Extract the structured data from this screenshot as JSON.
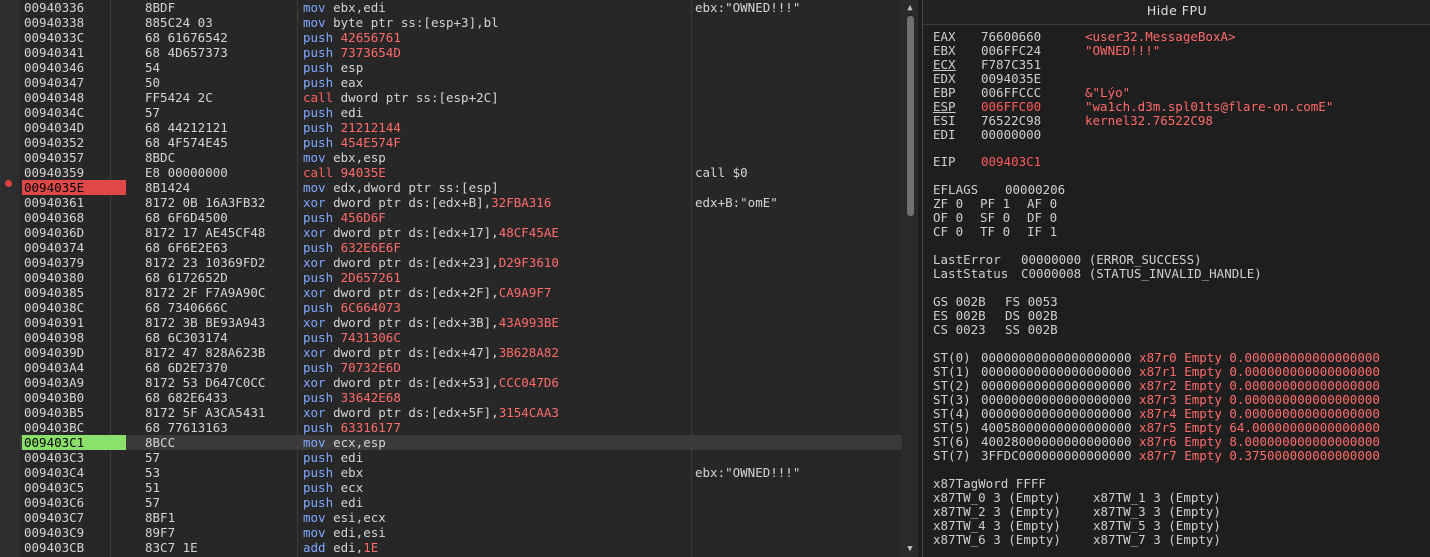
{
  "disasm": {
    "rows": [
      {
        "addr": "00940336",
        "bytes": "8BDF",
        "mn": "mov",
        "ops": "ebx,edi",
        "opsr": "",
        "cmt": "ebx:\"OWNED!!!\"",
        "mark": ""
      },
      {
        "addr": "00940338",
        "bytes": "885C24 03",
        "mn": "mov",
        "ops": "byte ptr ss:[esp+3],bl",
        "opsr": "",
        "cmt": "",
        "mark": ""
      },
      {
        "addr": "0094033C",
        "bytes": "68 61676542",
        "mn": "push",
        "ops": "",
        "opsr": "42656761",
        "cmt": "",
        "mark": ""
      },
      {
        "addr": "00940341",
        "bytes": "68 4D657373",
        "mn": "push",
        "ops": "",
        "opsr": "7373654D",
        "cmt": "",
        "mark": ""
      },
      {
        "addr": "00940346",
        "bytes": "54",
        "mn": "push",
        "ops": "esp",
        "opsr": "",
        "cmt": "",
        "mark": ""
      },
      {
        "addr": "00940347",
        "bytes": "50",
        "mn": "push",
        "ops": "eax",
        "opsr": "",
        "cmt": "",
        "mark": ""
      },
      {
        "addr": "00940348",
        "bytes": "FF5424 2C",
        "mn": "call",
        "ops": "dword ptr ss:[esp+2C]",
        "opsr": "",
        "cmt": "",
        "mark": ""
      },
      {
        "addr": "0094034C",
        "bytes": "57",
        "mn": "push",
        "ops": "edi",
        "opsr": "",
        "cmt": "",
        "mark": ""
      },
      {
        "addr": "0094034D",
        "bytes": "68 44212121",
        "mn": "push",
        "ops": "",
        "opsr": "21212144",
        "cmt": "",
        "mark": ""
      },
      {
        "addr": "00940352",
        "bytes": "68 4F574E45",
        "mn": "push",
        "ops": "",
        "opsr": "454E574F",
        "cmt": "",
        "mark": ""
      },
      {
        "addr": "00940357",
        "bytes": "8BDC",
        "mn": "mov",
        "ops": "ebx,esp",
        "opsr": "",
        "cmt": "",
        "mark": ""
      },
      {
        "addr": "00940359",
        "bytes": "E8 00000000",
        "mn": "call",
        "ops": "",
        "opsr": "94035E",
        "cmt": "call $0",
        "mark": ""
      },
      {
        "addr": "0094035E",
        "bytes": "8B1424",
        "mn": "mov",
        "ops": "edx,dword ptr ss:[esp]",
        "opsr": "",
        "cmt": "",
        "mark": "bp"
      },
      {
        "addr": "00940361",
        "bytes": "8172 0B 16A3FB32",
        "mn": "xor",
        "ops": "dword ptr ds:[edx+B],",
        "opsr": "32FBA316",
        "cmt": "edx+B:\"omE\"",
        "mark": ""
      },
      {
        "addr": "00940368",
        "bytes": "68 6F6D4500",
        "mn": "push",
        "ops": "",
        "opsr": "456D6F",
        "cmt": "",
        "mark": ""
      },
      {
        "addr": "0094036D",
        "bytes": "8172 17 AE45CF48",
        "mn": "xor",
        "ops": "dword ptr ds:[edx+17],",
        "opsr": "48CF45AE",
        "cmt": "",
        "mark": ""
      },
      {
        "addr": "00940374",
        "bytes": "68 6F6E2E63",
        "mn": "push",
        "ops": "",
        "opsr": "632E6E6F",
        "cmt": "",
        "mark": ""
      },
      {
        "addr": "00940379",
        "bytes": "8172 23 10369FD2",
        "mn": "xor",
        "ops": "dword ptr ds:[edx+23],",
        "opsr": "D29F3610",
        "cmt": "",
        "mark": ""
      },
      {
        "addr": "00940380",
        "bytes": "68 6172652D",
        "mn": "push",
        "ops": "",
        "opsr": "2D657261",
        "cmt": "",
        "mark": ""
      },
      {
        "addr": "00940385",
        "bytes": "8172 2F F7A9A90C",
        "mn": "xor",
        "ops": "dword ptr ds:[edx+2F],",
        "opsr": "CA9A9F7",
        "cmt": "",
        "mark": ""
      },
      {
        "addr": "0094038C",
        "bytes": "68 7340666C",
        "mn": "push",
        "ops": "",
        "opsr": "6C664073",
        "cmt": "",
        "mark": ""
      },
      {
        "addr": "00940391",
        "bytes": "8172 3B BE93A943",
        "mn": "xor",
        "ops": "dword ptr ds:[edx+3B],",
        "opsr": "43A993BE",
        "cmt": "",
        "mark": ""
      },
      {
        "addr": "00940398",
        "bytes": "68 6C303174",
        "mn": "push",
        "ops": "",
        "opsr": "7431306C",
        "cmt": "",
        "mark": ""
      },
      {
        "addr": "0094039D",
        "bytes": "8172 47 828A623B",
        "mn": "xor",
        "ops": "dword ptr ds:[edx+47],",
        "opsr": "3B628A82",
        "cmt": "",
        "mark": ""
      },
      {
        "addr": "009403A4",
        "bytes": "68 6D2E7370",
        "mn": "push",
        "ops": "",
        "opsr": "70732E6D",
        "cmt": "",
        "mark": ""
      },
      {
        "addr": "009403A9",
        "bytes": "8172 53 D647C0CC",
        "mn": "xor",
        "ops": "dword ptr ds:[edx+53],",
        "opsr": "CCC047D6",
        "cmt": "",
        "mark": ""
      },
      {
        "addr": "009403B0",
        "bytes": "68 682E6433",
        "mn": "push",
        "ops": "",
        "opsr": "33642E68",
        "cmt": "",
        "mark": ""
      },
      {
        "addr": "009403B5",
        "bytes": "8172 5F A3CA5431",
        "mn": "xor",
        "ops": "dword ptr ds:[edx+5F],",
        "opsr": "3154CAA3",
        "cmt": "",
        "mark": ""
      },
      {
        "addr": "009403BC",
        "bytes": "68 77613163",
        "mn": "push",
        "ops": "",
        "opsr": "63316177",
        "cmt": "",
        "mark": ""
      },
      {
        "addr": "009403C1",
        "bytes": "8BCC",
        "mn": "mov",
        "ops": "ecx,esp",
        "opsr": "",
        "cmt": "",
        "mark": "eip"
      },
      {
        "addr": "009403C3",
        "bytes": "57",
        "mn": "push",
        "ops": "edi",
        "opsr": "",
        "cmt": "",
        "mark": ""
      },
      {
        "addr": "009403C4",
        "bytes": "53",
        "mn": "push",
        "ops": "ebx",
        "opsr": "",
        "cmt": "ebx:\"OWNED!!!\"",
        "mark": ""
      },
      {
        "addr": "009403C5",
        "bytes": "51",
        "mn": "push",
        "ops": "ecx",
        "opsr": "",
        "cmt": "",
        "mark": ""
      },
      {
        "addr": "009403C6",
        "bytes": "57",
        "mn": "push",
        "ops": "edi",
        "opsr": "",
        "cmt": "",
        "mark": ""
      },
      {
        "addr": "009403C7",
        "bytes": "8BF1",
        "mn": "mov",
        "ops": "esi,ecx",
        "opsr": "",
        "cmt": "",
        "mark": ""
      },
      {
        "addr": "009403C9",
        "bytes": "89F7",
        "mn": "mov",
        "ops": "edi,esi",
        "opsr": "",
        "cmt": "",
        "mark": ""
      },
      {
        "addr": "009403CB",
        "bytes": "83C7 1E",
        "mn": "add",
        "ops": "edi,",
        "opsr": "1E",
        "cmt": "",
        "mark": ""
      }
    ]
  },
  "registers": {
    "header": "Hide FPU",
    "gp": [
      {
        "name": "EAX",
        "val": "76600660",
        "changed": false,
        "cmt": "<user32.MessageBoxA>",
        "u": false
      },
      {
        "name": "EBX",
        "val": "006FFC24",
        "changed": false,
        "cmt": "\"OWNED!!!\"",
        "u": false
      },
      {
        "name": "ECX",
        "val": "F787C351",
        "changed": false,
        "cmt": "",
        "u": true
      },
      {
        "name": "EDX",
        "val": "0094035E",
        "changed": false,
        "cmt": "",
        "u": false
      },
      {
        "name": "EBP",
        "val": "006FFCCC",
        "changed": false,
        "cmt": "&\"Lýo\"",
        "u": false
      },
      {
        "name": "ESP",
        "val": "006FFC00",
        "changed": true,
        "cmt": "\"wa1ch.d3m.spl01ts@flare-on.comE\"",
        "u": true
      },
      {
        "name": "ESI",
        "val": "76522C98",
        "changed": false,
        "cmt": "kernel32.76522C98",
        "u": false
      },
      {
        "name": "EDI",
        "val": "00000000",
        "changed": false,
        "cmt": "",
        "u": false
      }
    ],
    "eip": {
      "name": "EIP",
      "val": "009403C1"
    },
    "eflags": {
      "name": "EFLAGS",
      "val": "00000206"
    },
    "flags": [
      [
        {
          "n": "ZF",
          "v": "0"
        },
        {
          "n": "PF",
          "v": "1"
        },
        {
          "n": "AF",
          "v": "0"
        }
      ],
      [
        {
          "n": "OF",
          "v": "0"
        },
        {
          "n": "SF",
          "v": "0"
        },
        {
          "n": "DF",
          "v": "0"
        }
      ],
      [
        {
          "n": "CF",
          "v": "0"
        },
        {
          "n": "TF",
          "v": "0"
        },
        {
          "n": "IF",
          "v": "1"
        }
      ]
    ],
    "last_error": {
      "name": "LastError",
      "val": "00000000 (ERROR_SUCCESS)"
    },
    "last_status": {
      "name": "LastStatus",
      "val": "C0000008 (STATUS_INVALID_HANDLE)"
    },
    "segments": [
      [
        {
          "n": "GS",
          "v": "002B"
        },
        {
          "n": "FS",
          "v": "0053"
        }
      ],
      [
        {
          "n": "ES",
          "v": "002B"
        },
        {
          "n": "DS",
          "v": "002B"
        }
      ],
      [
        {
          "n": "CS",
          "v": "0023"
        },
        {
          "n": "SS",
          "v": "002B"
        }
      ]
    ],
    "fpu": [
      {
        "name": "ST(0)",
        "raw": "00000000000000000000",
        "tag": "x87r0",
        "state": "Empty",
        "val": "0.000000000000000000"
      },
      {
        "name": "ST(1)",
        "raw": "00000000000000000000",
        "tag": "x87r1",
        "state": "Empty",
        "val": "0.000000000000000000"
      },
      {
        "name": "ST(2)",
        "raw": "00000000000000000000",
        "tag": "x87r2",
        "state": "Empty",
        "val": "0.000000000000000000"
      },
      {
        "name": "ST(3)",
        "raw": "00000000000000000000",
        "tag": "x87r3",
        "state": "Empty",
        "val": "0.000000000000000000"
      },
      {
        "name": "ST(4)",
        "raw": "00000000000000000000",
        "tag": "x87r4",
        "state": "Empty",
        "val": "0.000000000000000000"
      },
      {
        "name": "ST(5)",
        "raw": "40058000000000000000",
        "tag": "x87r5",
        "state": "Empty",
        "val": "64.00000000000000000"
      },
      {
        "name": "ST(6)",
        "raw": "40028000000000000000",
        "tag": "x87r6",
        "state": "Empty",
        "val": "8.000000000000000000"
      },
      {
        "name": "ST(7)",
        "raw": "3FFDC000000000000000",
        "tag": "x87r7",
        "state": "Empty",
        "val": "0.375000000000000000"
      }
    ],
    "tagword": {
      "name": "x87TagWord",
      "val": "FFFF"
    },
    "tw": [
      [
        {
          "n": "x87TW_0",
          "v": "3 (Empty)"
        },
        {
          "n": "x87TW_1",
          "v": "3 (Empty)"
        }
      ],
      [
        {
          "n": "x87TW_2",
          "v": "3 (Empty)"
        },
        {
          "n": "x87TW_3",
          "v": "3 (Empty)"
        }
      ],
      [
        {
          "n": "x87TW_4",
          "v": "3 (Empty)"
        },
        {
          "n": "x87TW_5",
          "v": "3 (Empty)"
        }
      ],
      [
        {
          "n": "x87TW_6",
          "v": "3 (Empty)"
        },
        {
          "n": "x87TW_7",
          "v": "3 (Empty)"
        }
      ]
    ]
  }
}
